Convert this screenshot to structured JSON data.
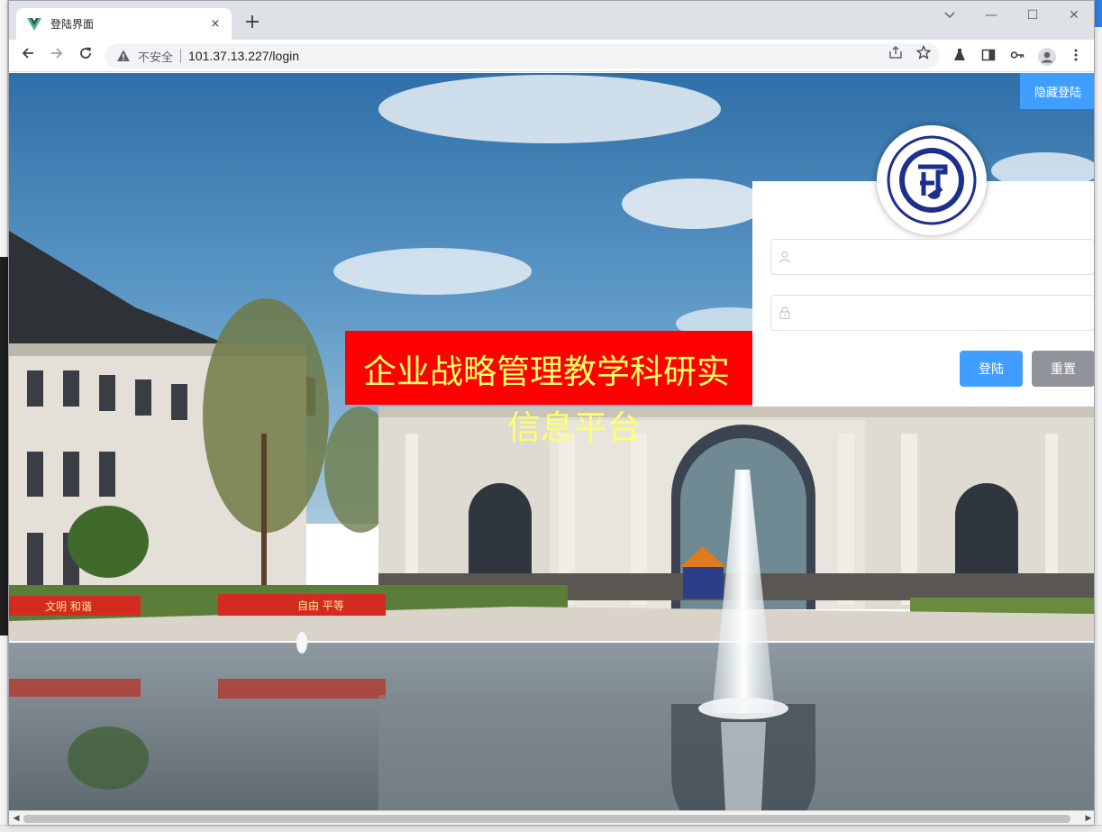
{
  "browser": {
    "tab_title": "登陆界面",
    "new_tab": "+",
    "close_tab": "×",
    "minimize": "—",
    "maximize": "☐",
    "close_window": "✕",
    "security_label": "不安全",
    "url": "101.37.13.227/login"
  },
  "page": {
    "hide_login_label": "隐藏登陆",
    "title_line1": "企业战略管理教学科研实",
    "title_line2": "信息平台",
    "username_placeholder": "",
    "password_placeholder": "",
    "login_button": "登陆",
    "reset_button": "重置",
    "sign_left": "文明 和谐",
    "sign_right": "自由 平等"
  },
  "colors": {
    "accent": "#409eff",
    "reset": "#909399",
    "title_bg": "#ff0000",
    "title_text": "#ffff66"
  }
}
